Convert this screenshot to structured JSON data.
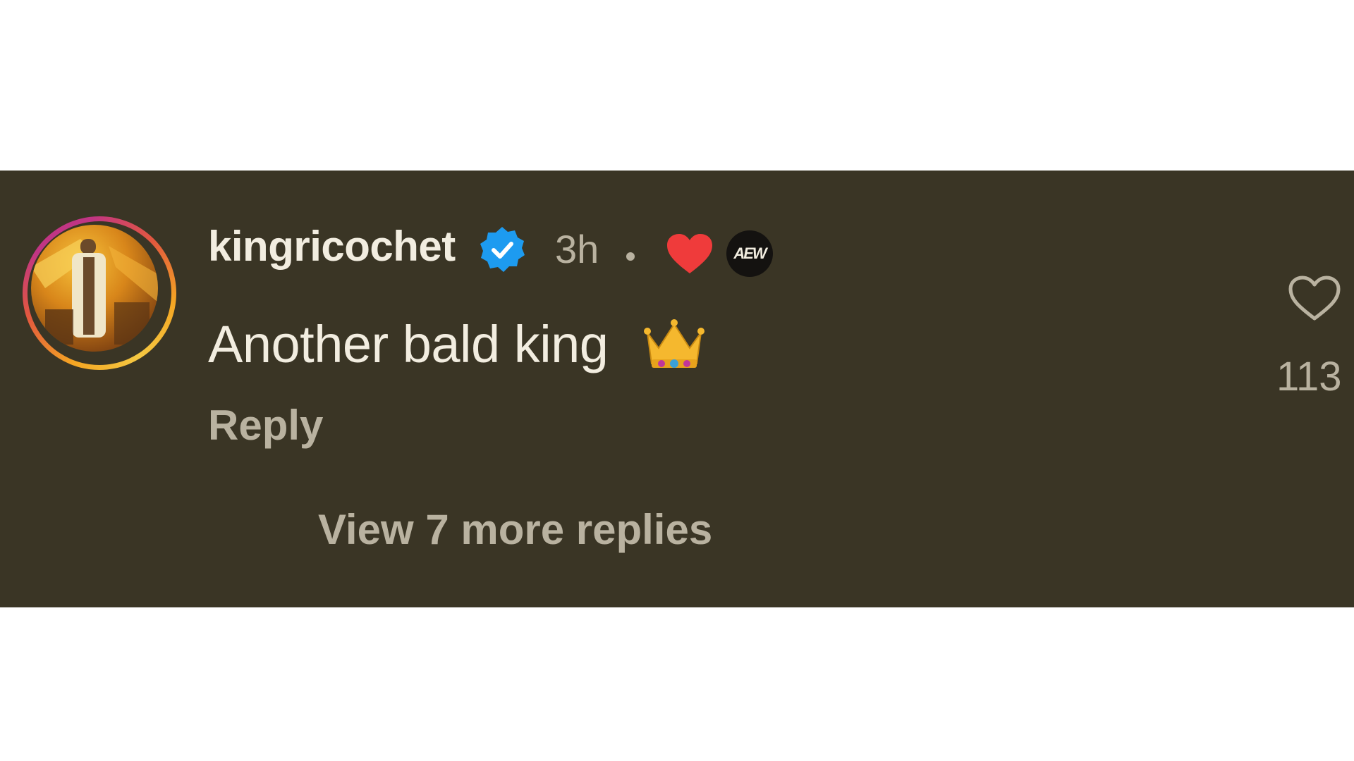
{
  "comment": {
    "username": "kingricochet",
    "timestamp": "3h",
    "text": "Another bald king",
    "reply_label": "Reply",
    "view_more_label": "View 7 more replies",
    "like_count": "113",
    "badges": {
      "verified_icon": "verified-check-icon",
      "heart_icon": "red-heart-icon",
      "brand_badge": "AEW"
    },
    "emoji": "crown-emoji"
  },
  "colors": {
    "background": "#3a3525",
    "primary_text": "#f2ede0",
    "secondary_text": "#b9b2a0",
    "verified_blue": "#1d9bf0",
    "heart_red": "#ef3b3b"
  }
}
